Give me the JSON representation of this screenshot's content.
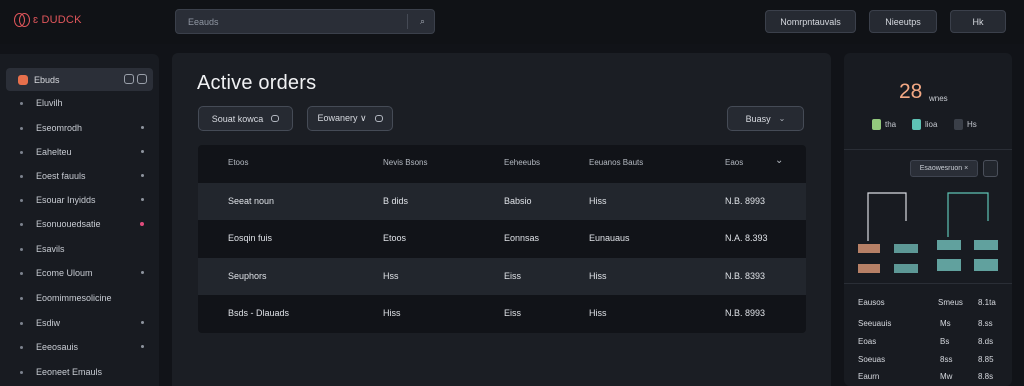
{
  "app": {
    "brand": "ɛ DUDCK"
  },
  "topbar": {
    "search_placeholder": "Eeauds",
    "search_icon": "search-icon",
    "btn1": "Nomrpntauvals",
    "btn2": "Nieeutps",
    "btn3": "Hk"
  },
  "sidebar": {
    "active": {
      "label": "Ebuds"
    },
    "items": [
      {
        "label": "Eluvilh"
      },
      {
        "label": "Eseomrodh"
      },
      {
        "label": "Eahelteu"
      },
      {
        "label": "Eoest fauuls"
      },
      {
        "label": "Esouar Inyidds"
      },
      {
        "label": "Esonuouedsatie"
      },
      {
        "label": "Esavils"
      },
      {
        "label": "Ecome Uloum"
      },
      {
        "label": "Eoomimmesolicine"
      },
      {
        "label": "Esdiw"
      },
      {
        "label": "Eeeosauis"
      },
      {
        "label": "Eeoneet Emauls"
      }
    ]
  },
  "main": {
    "title": "Active orders",
    "filter1": "Souat kowca",
    "filter2": "Eowanery ∨",
    "filter3": "Buasy",
    "columns": [
      "Etoos",
      "Nevis Bsons",
      "Eeheeubs",
      "Eeuanos Bauts",
      "Eaos"
    ],
    "rows": [
      [
        "Seeat noun",
        "B dids",
        "Babsio",
        "Hiss",
        "N.B. 8993"
      ],
      [
        "Eosqin fuis",
        "Etoos",
        "Eonnsas",
        "Eunauaus",
        "N.A. 8.393"
      ],
      [
        "Seuphors",
        "Hss",
        "Eiss",
        "Hiss",
        "N.B. 8393"
      ],
      [
        "Bsds - Dlauads",
        "Hiss",
        "Eiss",
        "Hiss",
        "N.B. 8993"
      ]
    ]
  },
  "panel": {
    "kpi_value": "28",
    "kpi_label": "wnes",
    "legend": [
      {
        "label": "tha",
        "color": "#93c97d"
      },
      {
        "label": "lioa",
        "color": "#5ec3b5"
      },
      {
        "label": "Hs",
        "color": "#3a3f48"
      }
    ],
    "select": "Esaowesruon ×",
    "stats": [
      [
        "Eausos",
        "Smeus",
        "8.1ta"
      ],
      [
        "Seeuauis",
        "Ms",
        "8.ss"
      ],
      [
        "Eoas",
        "Bs",
        "8.ds"
      ],
      [
        "Soeuas",
        "8ss",
        "8.85"
      ],
      [
        "Eaurn",
        "Mw",
        "8.8s"
      ]
    ]
  },
  "colors": {
    "accent": "#e7704c",
    "brand": "#e0565b",
    "kpi": "#f2a884",
    "teal": "#5ec3b5",
    "pink": "#e04c7c"
  }
}
